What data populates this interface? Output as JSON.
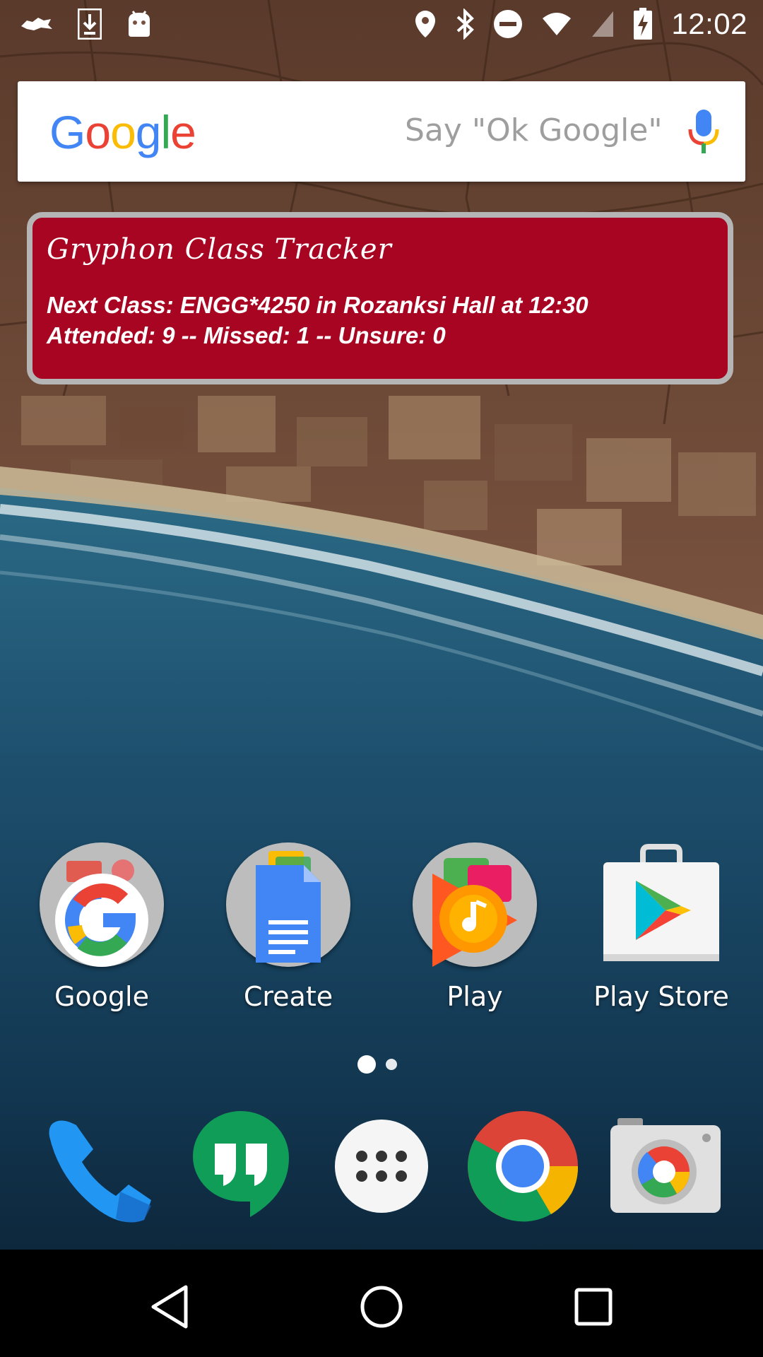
{
  "status_bar": {
    "time": "12:02",
    "left_icons": [
      "app-logo-icon",
      "download-icon",
      "android-icon"
    ],
    "right_icons": [
      "location-icon",
      "bluetooth-icon",
      "do-not-disturb-icon",
      "wifi-icon",
      "no-sim-icon",
      "battery-charging-icon"
    ]
  },
  "search": {
    "logo_letters": [
      "G",
      "o",
      "o",
      "g",
      "l",
      "e"
    ],
    "logo_colors": [
      "#4285F4",
      "#EA4335",
      "#FBBC05",
      "#4285F4",
      "#34A853",
      "#EA4335"
    ],
    "hint": "Say \"Ok Google\"",
    "mic_icon": "mic-icon"
  },
  "widget": {
    "title": "Gryphon Class Tracker",
    "next_class": "Next Class: ENGG*4250 in Rozanksi Hall at 12:30",
    "attendance": "Attended: 9 -- Missed: 1 -- Unsure: 0",
    "background_color": "#a70522"
  },
  "home_apps": [
    {
      "label": "Google",
      "icon": "google-folder-icon"
    },
    {
      "label": "Create",
      "icon": "docs-folder-icon"
    },
    {
      "label": "Play",
      "icon": "play-folder-icon"
    },
    {
      "label": "Play Store",
      "icon": "play-store-icon"
    }
  ],
  "page_indicator": {
    "pages": 2,
    "current": 1
  },
  "dock": [
    "phone-icon",
    "hangouts-icon",
    "app-drawer-icon",
    "chrome-icon",
    "camera-icon"
  ],
  "nav": [
    "back-icon",
    "home-icon",
    "recents-icon"
  ]
}
